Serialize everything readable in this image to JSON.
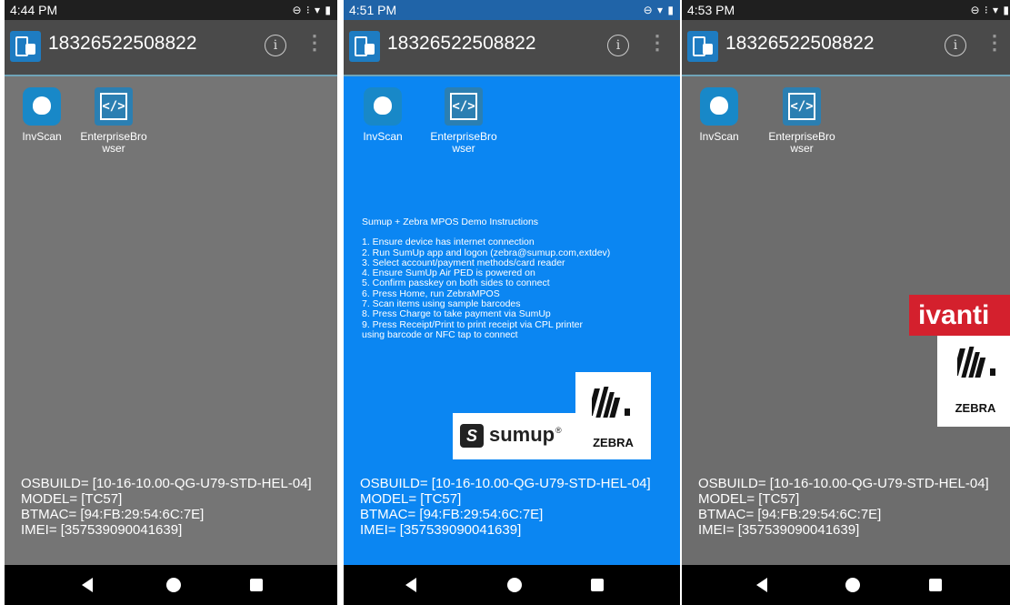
{
  "brand_colors": {
    "accent": "#1e7cc2",
    "blue_background": "#0b86f2",
    "ivanti_red": "#d4202d"
  },
  "panels": [
    {
      "status_time": "4:44 PM",
      "device_id": "18326522508822",
      "apps": [
        {
          "label": "InvScan",
          "icon": "invscan-icon"
        },
        {
          "label": "EnterpriseBrowser",
          "icon": "enterprise-browser-icon"
        }
      ],
      "info": [
        "OSBUILD= [10-16-10.00-QG-U79-STD-HEL-04]",
        "MODEL= [TC57]",
        "BTMAC= [94:FB:29:54:6C:7E]",
        "IMEI= [357539090041639]"
      ]
    },
    {
      "status_time": "4:51 PM",
      "device_id": "18326522508822",
      "apps": [
        {
          "label": "InvScan",
          "icon": "invscan-icon"
        },
        {
          "label": "EnterpriseBrowser",
          "icon": "enterprise-browser-icon"
        }
      ],
      "instructions_title": "Sumup + Zebra MPOS Demo Instructions",
      "instructions": [
        "1. Ensure device has internet connection",
        "2. Run SumUp app and logon (zebra@sumup.com,extdev)",
        "3. Select account/payment methods/card reader",
        "4. Ensure SumUp Air PED is powered on",
        "5. Confirm passkey on both sides to connect",
        "6. Press Home, run ZebraMPOS",
        "7. Scan items using sample barcodes",
        "8. Press Charge to take payment via SumUp",
        "9. Press Receipt/Print to print receipt via CPL printer",
        "using barcode or NFC tap to connect"
      ],
      "logos": {
        "sumup": "sumup",
        "sumup_mark": "®",
        "zebra": "ZEBRA"
      },
      "info": [
        "OSBUILD= [10-16-10.00-QG-U79-STD-HEL-04]",
        "MODEL= [TC57]",
        "BTMAC= [94:FB:29:54:6C:7E]",
        "IMEI= [357539090041639]"
      ]
    },
    {
      "status_time": "4:53 PM",
      "device_id": "18326522508822",
      "apps": [
        {
          "label": "InvScan",
          "icon": "invscan-icon"
        },
        {
          "label": "EnterpriseBrowser",
          "icon": "enterprise-browser-icon"
        }
      ],
      "logos": {
        "ivanti": "ivanti",
        "zebra": "ZEBRA"
      },
      "info": [
        "OSBUILD= [10-16-10.00-QG-U79-STD-HEL-04]",
        "MODEL= [TC57]",
        "BTMAC= [94:FB:29:54:6C:7E]",
        "IMEI= [357539090041639]"
      ]
    }
  ]
}
